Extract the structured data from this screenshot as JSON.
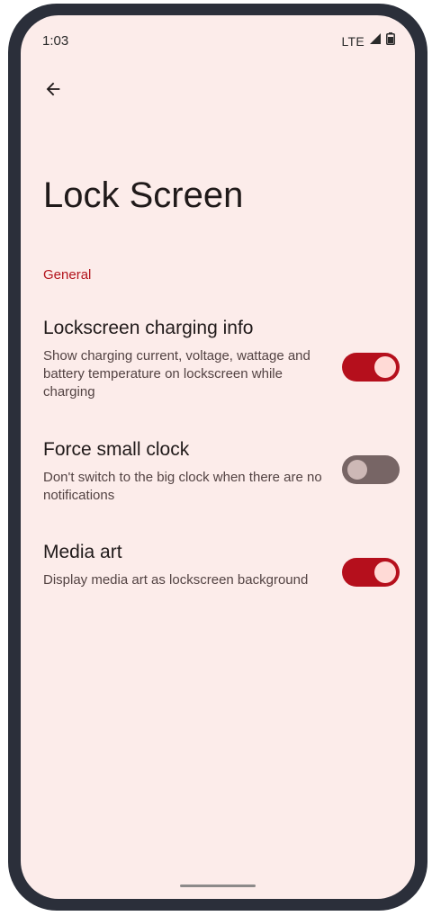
{
  "status_bar": {
    "time": "1:03",
    "network": "LTE",
    "icons": [
      "signal-icon",
      "battery-icon"
    ]
  },
  "header": {
    "back_icon": "arrow-back-icon",
    "title": "Lock Screen"
  },
  "section": {
    "label": "General"
  },
  "settings": [
    {
      "title": "Lockscreen charging info",
      "summary": "Show charging current, voltage, wattage and battery temperature on lockscreen while charging",
      "enabled": true
    },
    {
      "title": "Force small clock",
      "summary": "Don't switch to the big clock when there are no notifications",
      "enabled": false
    },
    {
      "title": "Media art",
      "summary": "Display media art as lockscreen background",
      "enabled": true
    }
  ],
  "colors": {
    "background": "#fcecea",
    "accent": "#b50f1c",
    "toggle_off": "#776565",
    "frame": "#2b2f3a"
  }
}
